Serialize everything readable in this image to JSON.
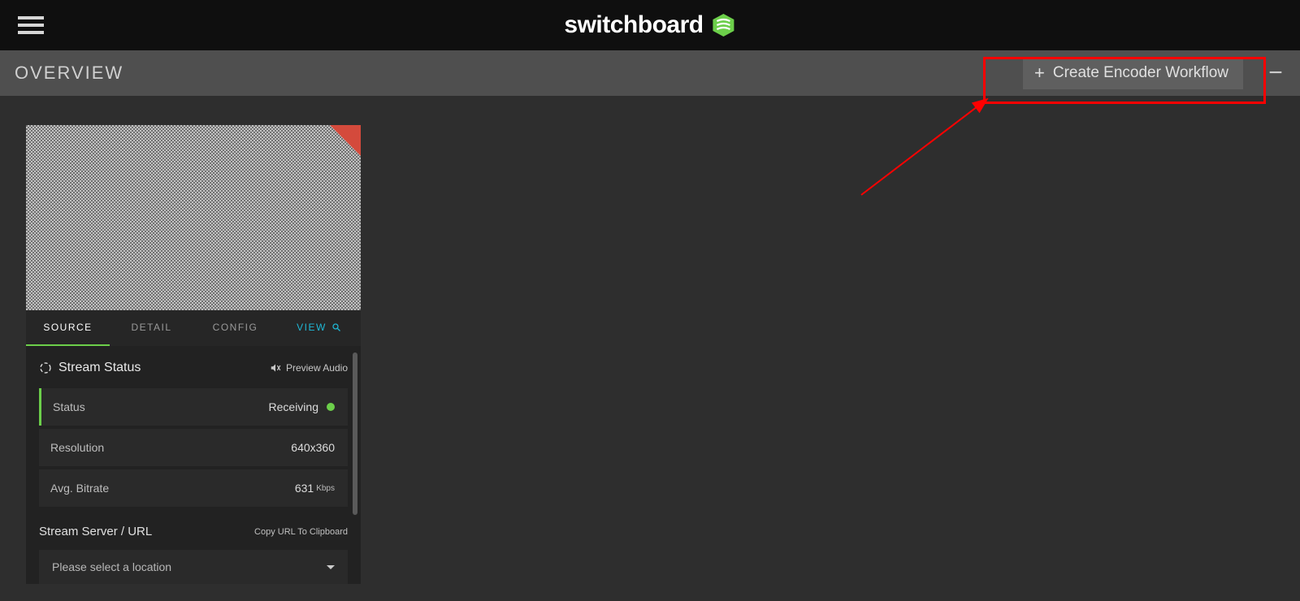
{
  "brand": {
    "name": "switchboard"
  },
  "subheader": {
    "title": "OVERVIEW",
    "cta": "Create Encoder Workflow"
  },
  "tabs": {
    "source": "SOURCE",
    "detail": "DETAIL",
    "config": "CONFIG",
    "view": "VIEW"
  },
  "panel": {
    "stream_status_title": "Stream Status",
    "preview_audio": "Preview Audio",
    "status_label": "Status",
    "status_value": "Receiving",
    "resolution_label": "Resolution",
    "resolution_value": "640x360",
    "bitrate_label": "Avg. Bitrate",
    "bitrate_value": "631",
    "bitrate_unit": "Kbps",
    "server_label": "Stream Server / URL",
    "copy_url": "Copy URL To Clipboard",
    "select_placeholder": "Please select a location"
  }
}
